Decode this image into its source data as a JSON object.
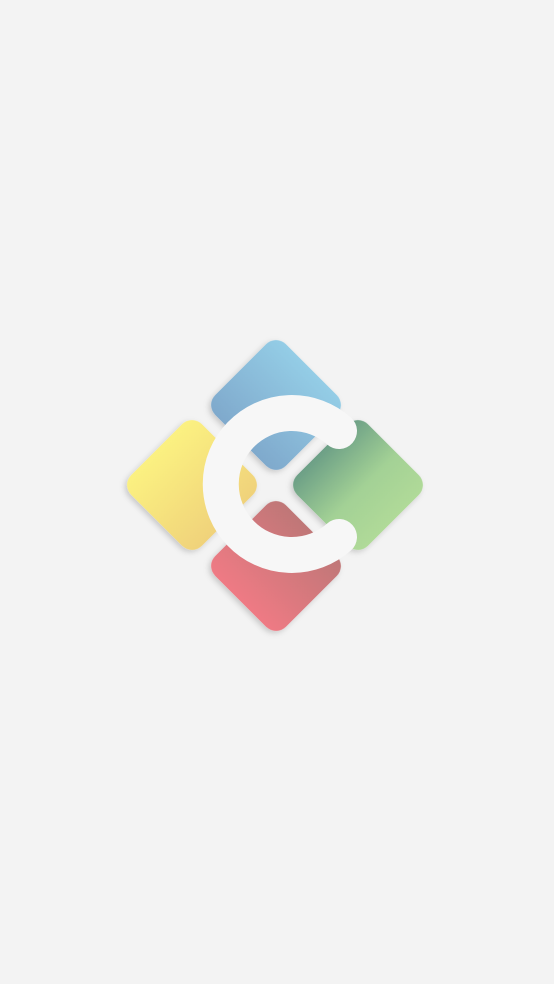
{
  "screen": {
    "type": "splash",
    "background_color": "#f3f3f3"
  },
  "logo": {
    "icon": "app-logo-icon",
    "letter_mark": "C",
    "colors": {
      "top": "#8ec8e2",
      "left": "#f6ee82",
      "right": "#a8d696",
      "bottom": "#e87880",
      "mark": "#f7f7f7"
    }
  }
}
